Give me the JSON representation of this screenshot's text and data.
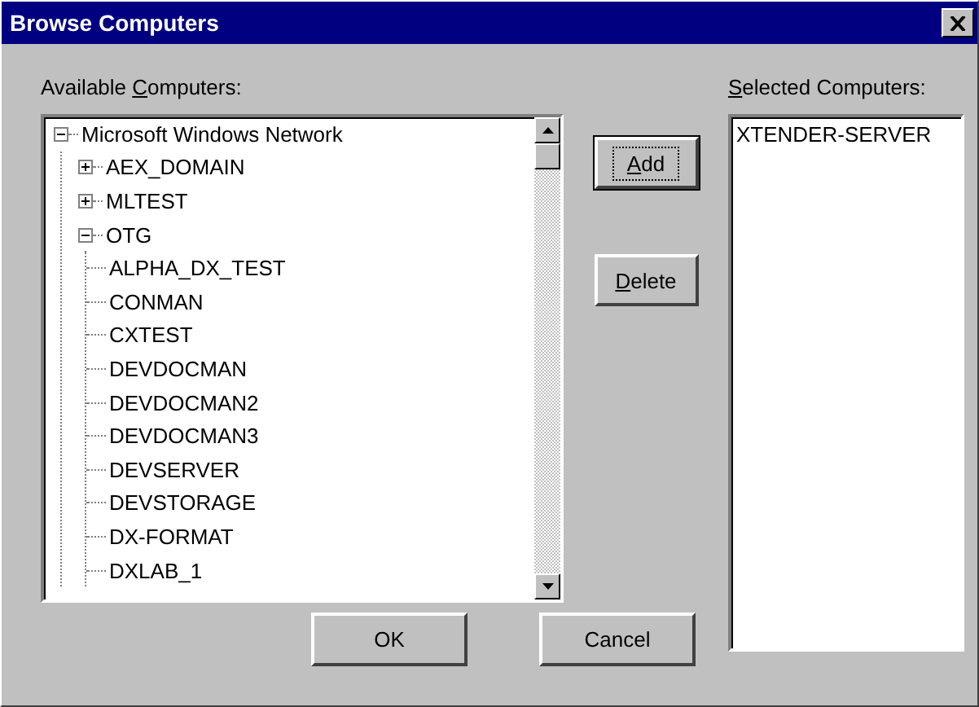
{
  "window": {
    "title": "Browse Computers"
  },
  "available": {
    "label": [
      {
        "text": "Available "
      },
      {
        "text": "C",
        "underline": true
      },
      {
        "text": "omputers:"
      }
    ],
    "tree": [
      {
        "label": "Microsoft Windows Network",
        "expanded": true,
        "children": [
          {
            "label": "AEX_DOMAIN",
            "expanded": false
          },
          {
            "label": "MLTEST",
            "expanded": false
          },
          {
            "label": "OTG",
            "expanded": true,
            "children": [
              {
                "label": "ALPHA_DX_TEST"
              },
              {
                "label": "CONMAN"
              },
              {
                "label": "CXTEST"
              },
              {
                "label": "DEVDOCMAN"
              },
              {
                "label": "DEVDOCMAN2"
              },
              {
                "label": "DEVDOCMAN3"
              },
              {
                "label": "DEVSERVER"
              },
              {
                "label": "DEVSTORAGE"
              },
              {
                "label": "DX-FORMAT"
              },
              {
                "label": "DXLAB_1"
              }
            ]
          }
        ]
      }
    ]
  },
  "actions": [
    {
      "label": [
        {
          "text": "A",
          "underline": true
        },
        {
          "text": "dd"
        }
      ],
      "default": true
    },
    {
      "label": [
        {
          "text": "D",
          "underline": true
        },
        {
          "text": "elete"
        }
      ],
      "default": false
    }
  ],
  "selected": {
    "label": [
      {
        "text": "S",
        "underline": true
      },
      {
        "text": "elected Computers:"
      }
    ],
    "items": [
      "XTENDER-SERVER"
    ]
  },
  "buttons": [
    {
      "label": "OK"
    },
    {
      "label": "Cancel"
    }
  ]
}
